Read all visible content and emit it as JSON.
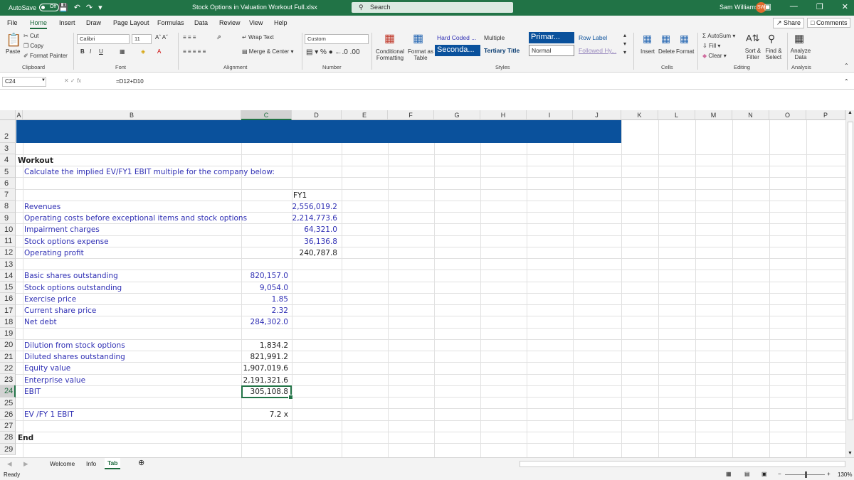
{
  "titlebar": {
    "autosave_label": "AutoSave",
    "autosave_state": "Off",
    "file_title": "Stock Options in Valuation Workout Full.xlsx",
    "search_placeholder": "Search",
    "user_name": "Sam Williams",
    "user_initials": "SW"
  },
  "menu": {
    "tabs": [
      "File",
      "Home",
      "Insert",
      "Draw",
      "Page Layout",
      "Formulas",
      "Data",
      "Review",
      "View",
      "Help"
    ],
    "active": "Home",
    "share_label": "Share",
    "comments_label": "Comments"
  },
  "ribbon": {
    "clipboard": {
      "paste": "Paste",
      "cut": "Cut",
      "copy": "Copy",
      "format_painter": "Format Painter",
      "label": "Clipboard"
    },
    "font": {
      "name": "Calibri",
      "size": "11",
      "label": "Font"
    },
    "alignment": {
      "wrap_text": "Wrap Text",
      "merge_center": "Merge & Center",
      "label": "Alignment"
    },
    "number": {
      "format": "Custom",
      "label": "Number"
    },
    "styles": {
      "conditional": "Conditional Formatting",
      "format_as_table": "Format as Table",
      "cells": [
        "Hard Coded ...",
        "Multiple",
        "Primar...",
        "Row Label",
        "Seconda...",
        "Tertiary Title",
        "Normal",
        "Followed Hy..."
      ],
      "label": "Styles"
    },
    "cells": {
      "insert": "Insert",
      "delete": "Delete",
      "format": "Format",
      "label": "Cells"
    },
    "editing": {
      "autosum": "AutoSum",
      "fill": "Fill",
      "clear": "Clear",
      "sort_filter": "Sort & Filter",
      "find_select": "Find & Select",
      "label": "Editing"
    },
    "analysis": {
      "analyze_data": "Analyze Data",
      "label": "Analysis"
    }
  },
  "formula_bar": {
    "name_box": "C24",
    "formula": "=D12+D10"
  },
  "grid": {
    "columns": [
      "A",
      "B",
      "C",
      "D",
      "E",
      "F",
      "G",
      "H",
      "I",
      "J",
      "K",
      "L",
      "M",
      "N",
      "O",
      "P"
    ],
    "rows": [
      "2",
      "3",
      "4",
      "5",
      "6",
      "7",
      "8",
      "9",
      "10",
      "11",
      "12",
      "13",
      "14",
      "15",
      "16",
      "17",
      "18",
      "19",
      "20",
      "21",
      "22",
      "23",
      "24",
      "25",
      "26",
      "27",
      "28",
      "29"
    ],
    "selected_column": "C",
    "selected_row": "24",
    "heading": "Workout",
    "instruction": "Calculate the implied EV/FY1 EBIT multiple for the company below:",
    "period_header": "FY1",
    "income_items": [
      {
        "label": "Revenues",
        "value": "2,556,019.2"
      },
      {
        "label": "Operating costs before exceptional items and stock options",
        "value": "2,214,773.6"
      },
      {
        "label": "Impairment charges",
        "value": "64,321.0"
      },
      {
        "label": "Stock options expense",
        "value": "36,136.8"
      },
      {
        "label": "Operating profit",
        "value": "240,787.8"
      }
    ],
    "share_items": [
      {
        "label": "Basic shares outstanding",
        "value": "820,157.0"
      },
      {
        "label": "Stock options outstanding",
        "value": "9,054.0"
      },
      {
        "label": "Exercise price",
        "value": "1.85"
      },
      {
        "label": "Current share price",
        "value": "2.32"
      },
      {
        "label": "Net debt",
        "value": "284,302.0"
      }
    ],
    "calc_items": [
      {
        "label": "Dilution from stock options",
        "value": "1,834.2"
      },
      {
        "label": "Diluted shares outstanding",
        "value": "821,991.2"
      },
      {
        "label": "Equity value",
        "value": "1,907,019.6"
      },
      {
        "label": "Enterprise value",
        "value": "2,191,321.6"
      },
      {
        "label": "EBIT",
        "value": "305,108.8"
      }
    ],
    "multiple_label": "EV /FY 1 EBIT",
    "multiple_value": "7.2 x",
    "end_label": "End"
  },
  "sheets": {
    "tabs": [
      "Welcome",
      "Info",
      "Tab"
    ],
    "active": "Tab"
  },
  "status": {
    "mode": "Ready",
    "zoom": "130%"
  },
  "colors": {
    "excel_green": "#217346",
    "banner_blue": "#0a519c",
    "input_blue": "#2f2fb4"
  }
}
